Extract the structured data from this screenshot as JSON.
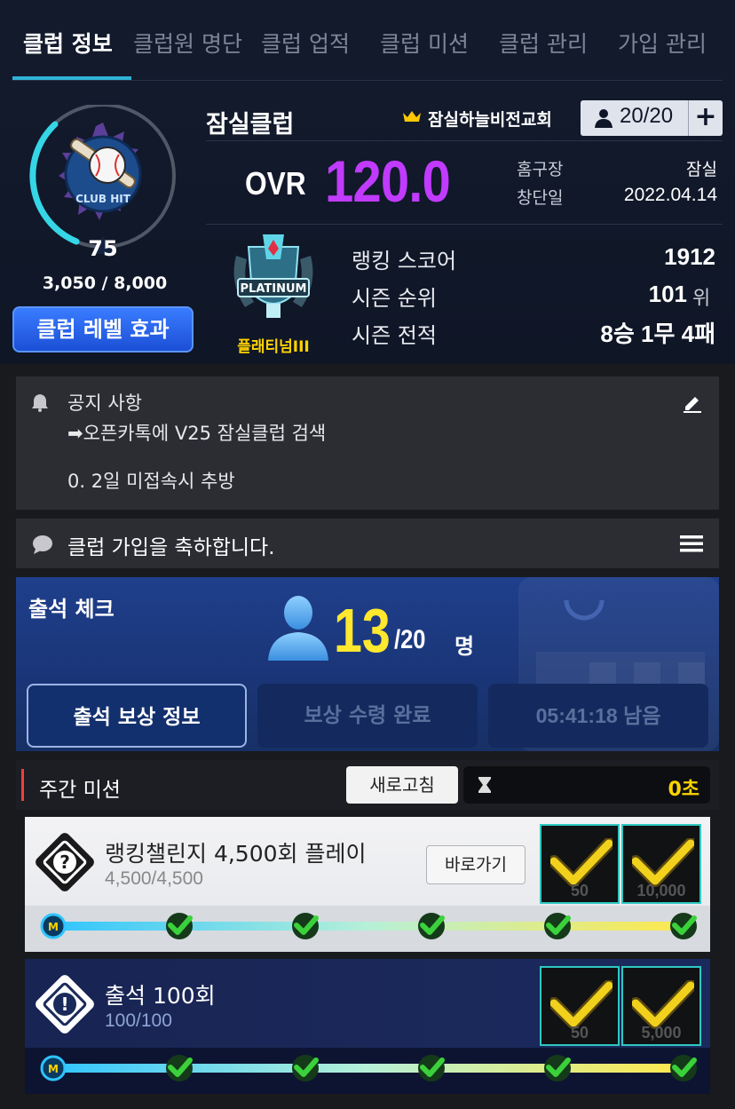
{
  "tabs": [
    {
      "label": "클럽 정보",
      "active": true
    },
    {
      "label": "클럽원 명단",
      "active": false
    },
    {
      "label": "클럽 업적",
      "active": false
    },
    {
      "label": "클럽 미션",
      "active": false
    },
    {
      "label": "클럽 관리",
      "active": false
    },
    {
      "label": "가입 관리",
      "active": false
    }
  ],
  "club": {
    "level": "75",
    "exp": "3,050 / 8,000",
    "exp_fraction": 0.38,
    "level_effect_button": "클럽 레벨 효과",
    "emblem_text": "CLUB HIT",
    "name": "잠실클럽",
    "leader": "잠실하늘비전교회",
    "members": "20/20",
    "ovr_label": "OVR",
    "ovr_value": "120.0",
    "home_label": "홈구장",
    "home_value": "잠실",
    "founded_label": "창단일",
    "founded_value": "2022.04.14",
    "tier_badge_text": "PLATINUM",
    "tier_label": "플래티넘III",
    "ranking_score_label": "랭킹 스코어",
    "ranking_score": "1912",
    "season_rank_label": "시즌 순위",
    "season_rank": "101",
    "season_rank_unit": "위",
    "season_record_label": "시즌 전적",
    "season_record": "8승 1무 4패"
  },
  "notice": {
    "title": "공지 사항",
    "line1": "➡오픈카톡에 V25 잠실클럽 검색",
    "line2": "0. 2일 미접속시 추방"
  },
  "chat": {
    "message": "클럽 가입을 축하합니다."
  },
  "attendance": {
    "title": "출석 체크",
    "count": "13",
    "total": "/20",
    "unit": "명",
    "reward_info_button": "출석 보상 정보",
    "claimed_button": "보상 수령 완료",
    "timer": "05:41:18 남음"
  },
  "weekly": {
    "title": "주간 미션",
    "refresh_button": "새로고침",
    "timer": "0초",
    "missions": [
      {
        "title": "랭킹챌린지 4,500회 플레이",
        "progress": "4,500/4,500",
        "goto_button": "바로가기",
        "rewards": [
          "50",
          "10,000"
        ],
        "checkpoints": 5
      },
      {
        "title": "출석 100회",
        "progress": "100/100",
        "rewards": [
          "50",
          "5,000"
        ],
        "checkpoints": 5
      }
    ]
  },
  "colors": {
    "ovr": "#c03bff",
    "tier": "#ffd400",
    "attendance_count": "#ffe82e",
    "tab_underline": "#2fb3d7",
    "check": "#3bd13b"
  },
  "track_marker": "M"
}
